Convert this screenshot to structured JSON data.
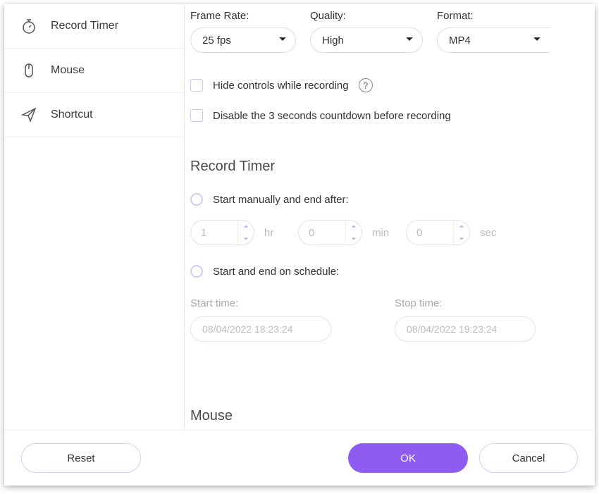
{
  "sidebar": {
    "items": [
      {
        "label": "Record Timer"
      },
      {
        "label": "Mouse"
      },
      {
        "label": "Shortcut"
      }
    ]
  },
  "settings": {
    "frame_rate": {
      "label": "Frame Rate:",
      "value": "25 fps"
    },
    "quality": {
      "label": "Quality:",
      "value": "High"
    },
    "format": {
      "label": "Format:",
      "value": "MP4"
    }
  },
  "options": {
    "hide_controls": "Hide controls while recording",
    "disable_countdown": "Disable the 3 seconds countdown before recording"
  },
  "record_timer": {
    "title": "Record Timer",
    "manual_label": "Start manually and end after:",
    "schedule_label": "Start and end on schedule:",
    "hr_value": "1",
    "hr_unit": "hr",
    "min_value": "0",
    "min_unit": "min",
    "sec_value": "0",
    "sec_unit": "sec",
    "start_time_label": "Start time:",
    "stop_time_label": "Stop time:",
    "start_time_value": "08/04/2022 18:23:24",
    "stop_time_value": "08/04/2022 19:23:24"
  },
  "mouse_section": {
    "title": "Mouse"
  },
  "buttons": {
    "reset": "Reset",
    "ok": "OK",
    "cancel": "Cancel"
  }
}
